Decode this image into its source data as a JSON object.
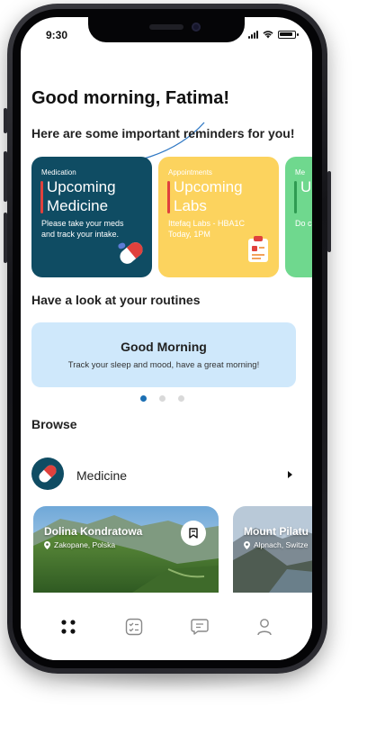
{
  "status_bar": {
    "time": "9:30"
  },
  "header": {
    "greeting": "Good morning, Fatima!"
  },
  "reminders": {
    "title": "Here are some important reminders for you!",
    "cards": [
      {
        "tag": "Medication",
        "title": "Upcoming Medicine",
        "description": "Please take your meds and track your intake.",
        "icon": "pill-icon",
        "color": "#0f4c63"
      },
      {
        "tag": "Appointments",
        "title": "Upcoming Labs",
        "description": "Ittefaq Labs - HBA1C Today, 1PM",
        "icon": "clipboard-icon",
        "color": "#fcd35e"
      },
      {
        "tag": "Me",
        "title": "U M",
        "description": "Do car",
        "color": "#6fd88e"
      }
    ]
  },
  "routines": {
    "title": "Have a look at your routines",
    "card_title": "Good Morning",
    "card_subtitle": "Track your sleep and mood, have a great morning!",
    "pager": {
      "count": 3,
      "active": 0
    }
  },
  "browse": {
    "title": "Browse",
    "items": [
      {
        "label": "Medicine",
        "icon": "pill-icon"
      }
    ]
  },
  "places": [
    {
      "name": "Dolina Kondratowa",
      "location": "Zakopane, Polska"
    },
    {
      "name": "Mount Pilatu",
      "location": "Alpnach, Switze"
    }
  ],
  "bottom_nav": [
    {
      "icon": "grid-dots-icon",
      "active": true
    },
    {
      "icon": "checklist-icon"
    },
    {
      "icon": "chat-icon"
    },
    {
      "icon": "profile-icon"
    }
  ],
  "colors": {
    "accent": "#1b6fb3",
    "medication_card": "#0f4c63",
    "labs_card": "#fcd35e",
    "routine_card": "#cfe8fb"
  }
}
